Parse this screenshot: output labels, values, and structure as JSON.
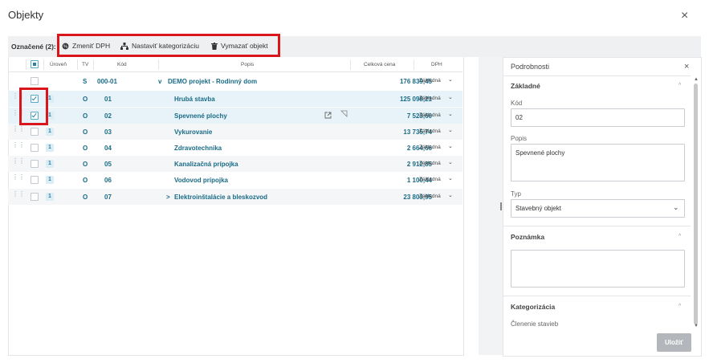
{
  "dialog": {
    "title": "Objekty",
    "close": "×"
  },
  "toolbar": {
    "selected_label": "Označené (2):",
    "change_vat": "Zmeniť DPH",
    "set_category": "Nastaviť kategorizáciu",
    "delete": "Vymazať objekt"
  },
  "table": {
    "headers": {
      "level": "Úroveň",
      "tv": "TV",
      "code": "Kód",
      "desc": "Popis",
      "price": "Celková cena",
      "vat": "DPH"
    },
    "rows": [
      {
        "level": "",
        "tv": "S",
        "code": "000-01",
        "desc": "DEMO projekt - Rodinný dom",
        "price": "176 839,45",
        "vat": "Základná",
        "expander": "v",
        "checked": false
      },
      {
        "level": "1",
        "tv": "O",
        "code": "01",
        "desc": "Hrubá stavba",
        "price": "125 098,21",
        "vat": "Základná",
        "expander": "",
        "checked": true
      },
      {
        "level": "1",
        "tv": "O",
        "code": "02",
        "desc": "Spevnené plochy",
        "price": "7 523,60",
        "vat": "Základná",
        "expander": "",
        "checked": true
      },
      {
        "level": "1",
        "tv": "O",
        "code": "03",
        "desc": "Vykurovanie",
        "price": "13 735,74",
        "vat": "Základná",
        "expander": "",
        "checked": false
      },
      {
        "level": "1",
        "tv": "O",
        "code": "04",
        "desc": "Zdravotechnika",
        "price": "2 664,66",
        "vat": "Základná",
        "expander": "",
        "checked": false
      },
      {
        "level": "1",
        "tv": "O",
        "code": "05",
        "desc": "Kanalizačná prípojka",
        "price": "2 912,85",
        "vat": "Základná",
        "expander": "",
        "checked": false
      },
      {
        "level": "1",
        "tv": "O",
        "code": "06",
        "desc": "Vodovod prípojka",
        "price": "1 100,44",
        "vat": "Základná",
        "expander": "",
        "checked": false
      },
      {
        "level": "1",
        "tv": "O",
        "code": "07",
        "desc": "Elektroinštalácie a bleskozvod",
        "price": "23 803,95",
        "vat": "Základná",
        "expander": ">",
        "checked": false
      }
    ]
  },
  "details": {
    "title": "Podrobnosti",
    "close": "×",
    "basic": "Základné",
    "code_label": "Kód",
    "code_value": "02",
    "desc_label": "Popis",
    "desc_value": "Spevnené plochy",
    "type_label": "Typ",
    "type_value": "Stavebný objekt",
    "note": "Poznámka",
    "note_value": "",
    "category": "Kategorizácia",
    "category_sub": "Členenie stavieb",
    "save": "Uložiť"
  },
  "colors": {
    "accent": "#1a6b86",
    "highlight": "#d9161c"
  }
}
